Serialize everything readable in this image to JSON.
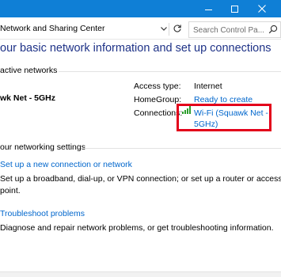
{
  "window": {
    "accent_color": "#0f7fd6",
    "controls": {
      "minimize": "minimize-icon",
      "maximize": "maximize-icon",
      "close": "close-icon"
    }
  },
  "address": {
    "breadcrumb": "Network and Sharing Center",
    "search_placeholder": "Search Control Pa..."
  },
  "main": {
    "title": "our basic network information and set up connections",
    "active_networks_label": "active networks",
    "network_name": "wk Net - 5GHz",
    "properties": {
      "access_type_label": "Access type:",
      "access_type_value": "Internet",
      "homegroup_label": "HomeGroup:",
      "homegroup_value": "Ready to create",
      "connections_label": "Connections:",
      "connections_value_line1": "Wi-Fi (Squawk Net -",
      "connections_value_line2": "5GHz)"
    },
    "settings_label": "our networking settings",
    "tasks": [
      {
        "link": "Set up a new connection or network",
        "desc_line1": "Set up a broadband, dial-up, or VPN connection; or set up a router or access",
        "desc_line2": "point."
      },
      {
        "link": "Troubleshoot problems",
        "desc_line1": "Diagnose and repair network problems, or get troubleshooting information."
      }
    ]
  },
  "colors": {
    "title_blue": "#1e3287",
    "link_blue": "#0066cc",
    "highlight_red": "#e3001b"
  }
}
